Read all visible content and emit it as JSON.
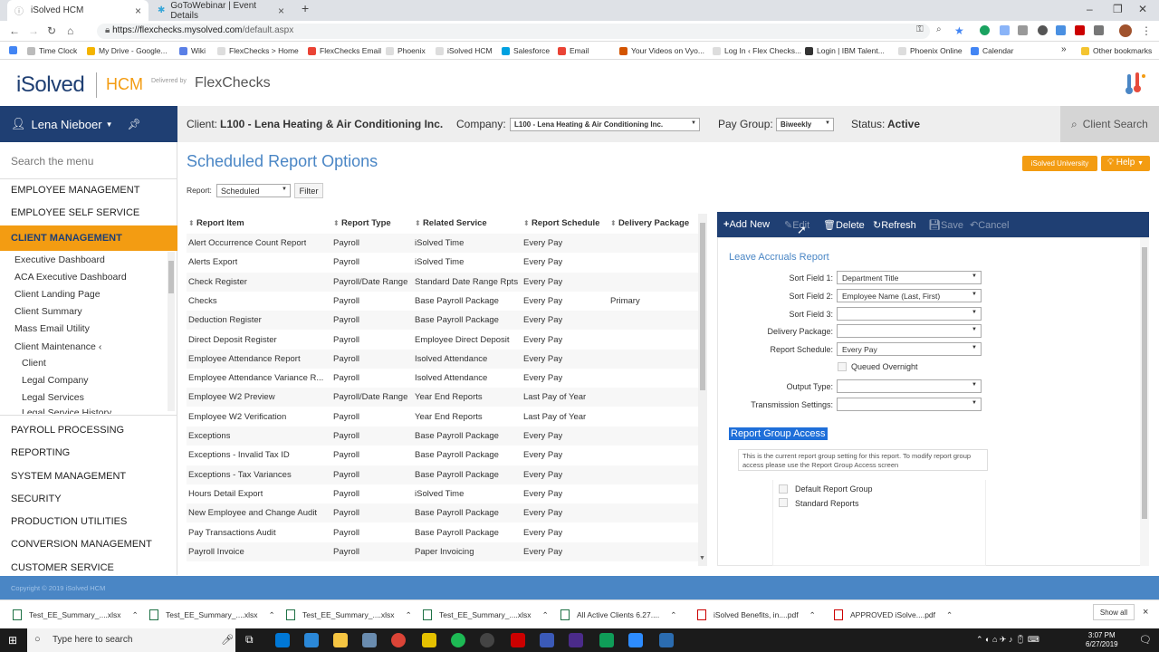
{
  "browser": {
    "tabs": [
      {
        "title": "iSolved HCM",
        "active": true
      },
      {
        "title": "GoToWebinar | Event Details",
        "active": false
      }
    ],
    "url_host": "https://flexchecks.mysolved.com",
    "url_path": "/default.aspx",
    "bookmarks": [
      "Time Clock",
      "My Drive - Google...",
      "Wiki",
      "FlexChecks > Home",
      "FlexChecks Email",
      "Phoenix",
      "iSolved HCM",
      "Salesforce",
      "Email",
      "Your Videos on Vyo...",
      "Log In ‹ Flex Checks...",
      "Login | IBM Talent...",
      "Phoenix Online",
      "Calendar",
      "Other bookmarks"
    ]
  },
  "header": {
    "logo_main": "iSolved",
    "logo_hcm": "HCM",
    "delivered_by": "Delivered by",
    "partner": "FlexChecks"
  },
  "user": {
    "name": "Lena Nieboer"
  },
  "client_bar": {
    "client_label": "Client:",
    "client_value": "L100 - Lena Heating & Air Conditioning Inc.",
    "company_label": "Company:",
    "company_value": "L100 - Lena Heating & Air Conditioning Inc.",
    "paygroup_label": "Pay Group:",
    "paygroup_value": "Biweekly",
    "status_label": "Status:",
    "status_value": "Active",
    "client_search": "Client Search"
  },
  "sidebar": {
    "search_placeholder": "Search the menu",
    "top_items": [
      "EMPLOYEE MANAGEMENT",
      "EMPLOYEE SELF SERVICE"
    ],
    "active_item": "CLIENT MANAGEMENT",
    "sub_items": [
      "Executive Dashboard",
      "ACA Executive Dashboard",
      "Client Landing Page",
      "Client Summary",
      "Mass Email Utility",
      "Client Maintenance"
    ],
    "sub_sub_items": [
      "Client",
      "Legal Company",
      "Legal Services",
      "Legal Service History"
    ],
    "bottom_items": [
      "PAYROLL PROCESSING",
      "REPORTING",
      "SYSTEM MANAGEMENT",
      "SECURITY",
      "PRODUCTION UTILITIES",
      "CONVERSION MANAGEMENT",
      "CUSTOMER SERVICE"
    ]
  },
  "main": {
    "title": "Scheduled Report Options",
    "university_btn": "iSolved University",
    "help_btn": "Help",
    "report_label": "Report:",
    "report_value": "Scheduled",
    "filter_btn": "Filter",
    "columns": [
      "Report Item",
      "Report Type",
      "Related Service",
      "Report Schedule",
      "Delivery Package"
    ],
    "rows": [
      [
        "Alert Occurrence Count Report",
        "Payroll",
        "iSolved Time",
        "Every Pay",
        ""
      ],
      [
        "Alerts Export",
        "Payroll",
        "iSolved Time",
        "Every Pay",
        ""
      ],
      [
        "Check Register",
        "Payroll/Date Range",
        "Standard Date Range Rpts",
        "Every Pay",
        ""
      ],
      [
        "Checks",
        "Payroll",
        "Base Payroll Package",
        "Every Pay",
        "Primary"
      ],
      [
        "Deduction Register",
        "Payroll",
        "Base Payroll Package",
        "Every Pay",
        ""
      ],
      [
        "Direct Deposit Register",
        "Payroll",
        "Employee Direct Deposit",
        "Every Pay",
        ""
      ],
      [
        "Employee Attendance Report",
        "Payroll",
        "Isolved Attendance",
        "Every Pay",
        ""
      ],
      [
        "Employee Attendance Variance R...",
        "Payroll",
        "Isolved Attendance",
        "Every Pay",
        ""
      ],
      [
        "Employee W2 Preview",
        "Payroll/Date Range",
        "Year End Reports",
        "Last Pay of Year",
        ""
      ],
      [
        "Employee W2 Verification",
        "Payroll",
        "Year End Reports",
        "Last Pay of Year",
        ""
      ],
      [
        "Exceptions",
        "Payroll",
        "Base Payroll Package",
        "Every Pay",
        ""
      ],
      [
        "Exceptions - Invalid Tax ID",
        "Payroll",
        "Base Payroll Package",
        "Every Pay",
        ""
      ],
      [
        "Exceptions - Tax Variances",
        "Payroll",
        "Base Payroll Package",
        "Every Pay",
        ""
      ],
      [
        "Hours Detail Export",
        "Payroll",
        "iSolved Time",
        "Every Pay",
        ""
      ],
      [
        "New Employee and Change Audit",
        "Payroll",
        "Base Payroll Package",
        "Every Pay",
        ""
      ],
      [
        "Pay Transactions Audit",
        "Payroll",
        "Base Payroll Package",
        "Every Pay",
        ""
      ],
      [
        "Payroll Invoice",
        "Payroll",
        "Paper Invoicing",
        "Every Pay",
        ""
      ]
    ]
  },
  "toolbar": {
    "add_new": "Add New",
    "edit": "Edit",
    "delete": "Delete",
    "refresh": "Refresh",
    "save": "Save",
    "cancel": "Cancel"
  },
  "detail": {
    "title": "Leave Accruals Report",
    "fields": [
      {
        "label": "Sort Field 1:",
        "value": "Department Title"
      },
      {
        "label": "Sort Field 2:",
        "value": "Employee Name (Last, First)"
      },
      {
        "label": "Sort Field 3:",
        "value": ""
      },
      {
        "label": "Delivery Package:",
        "value": ""
      },
      {
        "label": "Report Schedule:",
        "value": "Every Pay"
      }
    ],
    "queued_overnight": "Queued Overnight",
    "output_type_label": "Output Type:",
    "output_type_value": "",
    "transmission_label": "Transmission Settings:",
    "transmission_value": "",
    "group_access_title": "Report Group Access",
    "group_access_note": "This is the current report group setting for this report. To modify report group access please use the Report Group Access screen",
    "groups": [
      "Default Report Group",
      "Standard Reports"
    ]
  },
  "footer": {
    "copyright": "Copyright © 2019 iSolved HCM"
  },
  "downloads": [
    "Test_EE_Summary_....xlsx",
    "Test_EE_Summary_....xlsx",
    "Test_EE_Summary_....xlsx",
    "Test_EE_Summary_....xlsx",
    "All Active Clients 6.27....",
    "iSolved Benefits, in....pdf",
    "APPROVED iSolve....pdf"
  ],
  "show_all": "Show all",
  "taskbar": {
    "search_placeholder": "Type here to search",
    "time": "3:07 PM",
    "date": "6/27/2019"
  },
  "colors": {
    "navy": "#1f3f73",
    "orange": "#f39c12",
    "blue": "#4a86c5"
  }
}
